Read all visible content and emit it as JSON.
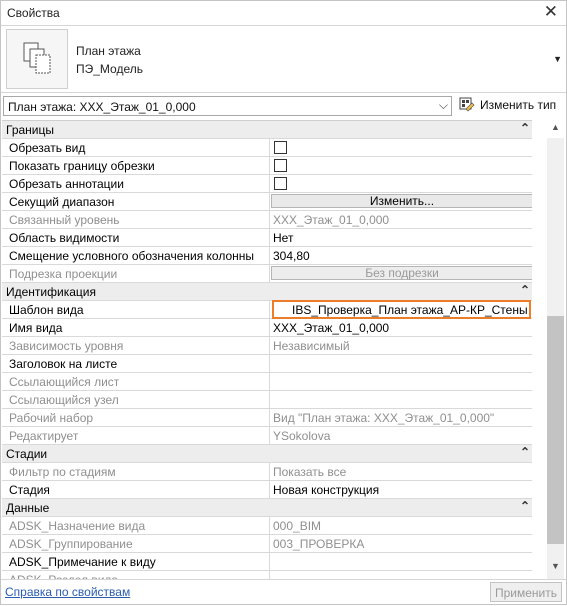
{
  "window": {
    "title": "Свойства"
  },
  "type_selector": {
    "line1": "План этажа",
    "line2": "ПЭ_Модель"
  },
  "instance": {
    "selected": "План этажа: XXX_Этаж_01_0,000",
    "edit_type_label": "Изменить тип"
  },
  "groups": [
    {
      "title": "Границы",
      "rows": [
        {
          "name": "Обрезать вид",
          "kind": "checkbox",
          "value": "",
          "grey": false
        },
        {
          "name": "Показать границу обрезки",
          "kind": "checkbox",
          "value": "",
          "grey": false
        },
        {
          "name": "Обрезать аннотации",
          "kind": "checkbox",
          "value": "",
          "grey": false
        },
        {
          "name": "Секущий диапазон",
          "kind": "button",
          "value": "Изменить...",
          "grey": false
        },
        {
          "name": "Связанный уровень",
          "kind": "text",
          "value": "XXX_Этаж_01_0,000",
          "grey": true
        },
        {
          "name": "Область видимости",
          "kind": "text",
          "value": "Нет",
          "grey": false
        },
        {
          "name": "Смещение условного обозначения колонны",
          "kind": "text",
          "value": "304,80",
          "grey": false
        },
        {
          "name": "Подрезка проекции",
          "kind": "button-disabled",
          "value": "Без подрезки",
          "grey": true
        }
      ]
    },
    {
      "title": "Идентификация",
      "rows": [
        {
          "name": "Шаблон вида",
          "kind": "highlight",
          "value": "IBS_Проверка_План этажа_АР-КР_Стены",
          "grey": false
        },
        {
          "name": "Имя вида",
          "kind": "text",
          "value": "XXX_Этаж_01_0,000",
          "grey": false
        },
        {
          "name": "Зависимость уровня",
          "kind": "text",
          "value": "Независимый",
          "grey": true
        },
        {
          "name": "Заголовок на листе",
          "kind": "text",
          "value": "",
          "grey": false
        },
        {
          "name": "Ссылающийся лист",
          "kind": "text",
          "value": "",
          "grey": true
        },
        {
          "name": "Ссылающийся узел",
          "kind": "text",
          "value": "",
          "grey": true
        },
        {
          "name": "Рабочий набор",
          "kind": "text",
          "value": "Вид \"План этажа: XXX_Этаж_01_0,000\"",
          "grey": true
        },
        {
          "name": "Редактирует",
          "kind": "text",
          "value": "YSokolova",
          "grey": true
        }
      ]
    },
    {
      "title": "Стадии",
      "rows": [
        {
          "name": "Фильтр по стадиям",
          "kind": "text",
          "value": "Показать все",
          "grey": true
        },
        {
          "name": "Стадия",
          "kind": "text",
          "value": "Новая конструкция",
          "grey": false
        }
      ]
    },
    {
      "title": "Данные",
      "rows": [
        {
          "name": "ADSK_Назначение вида",
          "kind": "text",
          "value": "000_BIM",
          "grey": true
        },
        {
          "name": "ADSK_Группирование",
          "kind": "text",
          "value": "003_ПРОВЕРКА",
          "grey": true
        },
        {
          "name": "ADSK_Примечание к виду",
          "kind": "text",
          "value": "",
          "grey": false
        },
        {
          "name": "ADSK_Раздел вида",
          "kind": "text",
          "value": "",
          "grey": true
        }
      ]
    }
  ],
  "footer": {
    "help_link": "Справка по свойствам",
    "apply_label": "Применить"
  },
  "colors": {
    "highlight": "#ee7d2a",
    "group_bg": "#ededed",
    "link": "#2a5db0"
  }
}
